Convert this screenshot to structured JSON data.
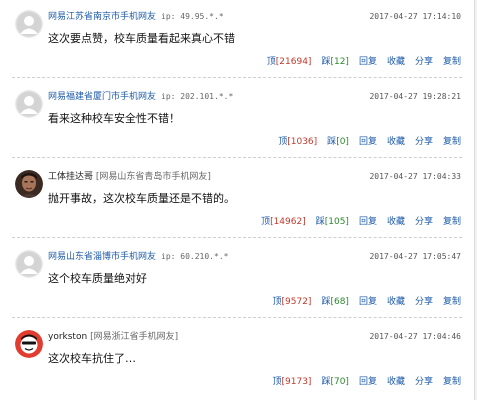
{
  "comments": [
    {
      "user": "网易江苏省南京市手机网友",
      "ip": "ip: 49.95.*.*",
      "from": "",
      "time": "2017-04-27  17:14:10",
      "content": "这次要点赞，校车质量看起来真心不错",
      "up_label": "顶",
      "up_count": "[21694]",
      "down_label": "踩",
      "down_count": "[12]",
      "reply": "回复",
      "collect": "收藏",
      "share": "分享",
      "copy": "复制"
    },
    {
      "user": "网易福建省厦门市手机网友",
      "ip": "ip: 202.101.*.*",
      "from": "",
      "time": "2017-04-27  19:28:21",
      "content": "看来这种校车安全性不错！",
      "up_label": "顶",
      "up_count": "[1036]",
      "down_label": "踩",
      "down_count": "[0]",
      "reply": "回复",
      "collect": "收藏",
      "share": "分享",
      "copy": "复制"
    },
    {
      "user": "工体挂达哥",
      "ip": "",
      "from": "[网易山东省青岛市手机网友]",
      "time": "2017-04-27  17:04:33",
      "content": "抛开事故，这次校车质量还是不错的。",
      "up_label": "顶",
      "up_count": "[14962]",
      "down_label": "踩",
      "down_count": "[105]",
      "reply": "回复",
      "collect": "收藏",
      "share": "分享",
      "copy": "复制"
    },
    {
      "user": "网易山东省淄博市手机网友",
      "ip": "ip: 60.210.*.*",
      "from": "",
      "time": "2017-04-27  17:05:47",
      "content": "这个校车质量绝对好",
      "up_label": "顶",
      "up_count": "[9572]",
      "down_label": "踩",
      "down_count": "[68]",
      "reply": "回复",
      "collect": "收藏",
      "share": "分享",
      "copy": "复制"
    },
    {
      "user": "yorkston",
      "ip": "",
      "from": "[网易浙江省手机网友]",
      "time": "2017-04-27  17:04:46",
      "content": "这次校车抗住了…",
      "up_label": "顶",
      "up_count": "[9173]",
      "down_label": "踩",
      "down_count": "[70]",
      "reply": "回复",
      "collect": "收藏",
      "share": "分享",
      "copy": "复制"
    }
  ],
  "colors": {
    "link": "#1d5aa8",
    "up_count": "#c0392b",
    "down_count": "#2a8a2a",
    "separator": "#cfcfcf"
  }
}
